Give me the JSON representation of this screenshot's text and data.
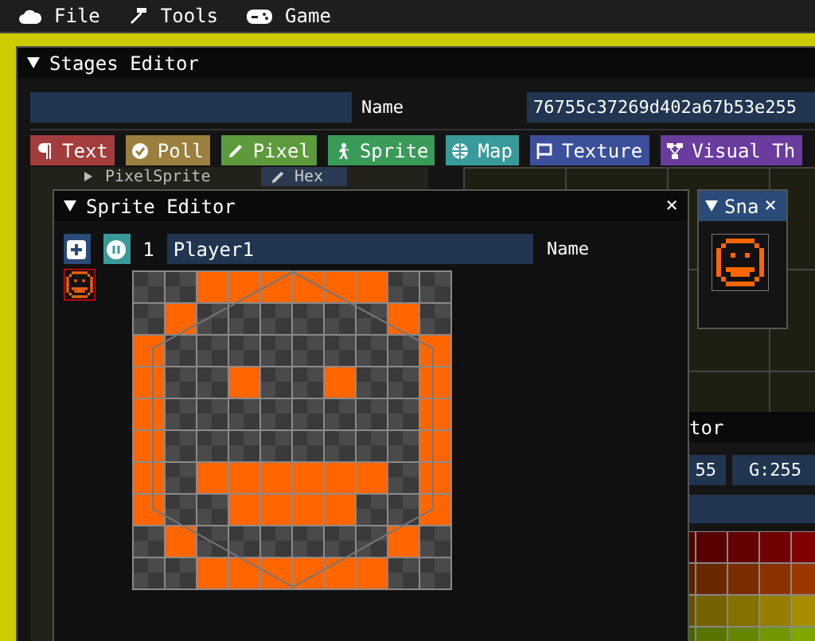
{
  "menu": [
    {
      "label": "File"
    },
    {
      "label": "Tools"
    },
    {
      "label": "Game"
    }
  ],
  "stages_editor": {
    "title": "Stages Editor",
    "name_label": "Name",
    "id_value": "76755c37269d402a67b53e255",
    "tool_buttons": [
      {
        "label": "Text",
        "color": "#a33c3c"
      },
      {
        "label": "Poll",
        "color": "#9a7f3e"
      },
      {
        "label": "Pixel",
        "color": "#5c9a3c"
      },
      {
        "label": "Sprite",
        "color": "#3a9a58"
      },
      {
        "label": "Map",
        "color": "#389a9a"
      },
      {
        "label": "Texture",
        "color": "#3c4f9a"
      },
      {
        "label": "Visual Th",
        "color": "#6a3c9e"
      }
    ],
    "items": [
      {
        "label": "PixelSprite",
        "button": "Hex"
      }
    ]
  },
  "sprite_editor": {
    "title": "Sprite Editor",
    "close": "×",
    "index": "1",
    "name_value": "Player1",
    "name_label": "Name",
    "pixels": [
      [
        false,
        false,
        true,
        true,
        true,
        true,
        true,
        true,
        false,
        false
      ],
      [
        false,
        true,
        false,
        false,
        false,
        false,
        false,
        false,
        true,
        false
      ],
      [
        true,
        false,
        false,
        false,
        false,
        false,
        false,
        false,
        false,
        true
      ],
      [
        true,
        false,
        false,
        true,
        false,
        false,
        true,
        false,
        false,
        true
      ],
      [
        true,
        false,
        false,
        false,
        false,
        false,
        false,
        false,
        false,
        true
      ],
      [
        true,
        false,
        false,
        false,
        false,
        false,
        false,
        false,
        false,
        true
      ],
      [
        true,
        false,
        true,
        true,
        true,
        true,
        true,
        true,
        false,
        true
      ],
      [
        true,
        false,
        false,
        true,
        true,
        true,
        true,
        false,
        false,
        true
      ],
      [
        false,
        true,
        false,
        false,
        false,
        false,
        false,
        false,
        true,
        false
      ],
      [
        false,
        false,
        true,
        true,
        true,
        true,
        true,
        true,
        false,
        false
      ]
    ]
  },
  "snapshot": {
    "title": "Sna",
    "close": "×"
  },
  "palette_editor": {
    "title": "tor",
    "r_value": "55",
    "g_value": "G:255"
  }
}
